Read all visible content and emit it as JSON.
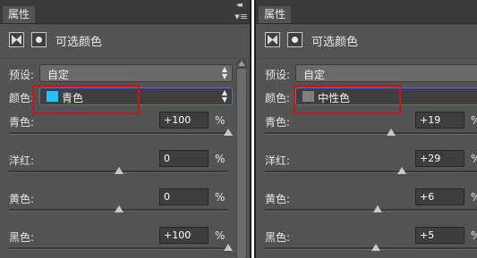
{
  "left": {
    "tab_label": "属性",
    "header_title": "可选颜色",
    "preset_label": "预设:",
    "preset_value": "自定",
    "color_label": "颜色:",
    "color_value": "青色",
    "swatch_color": "#1ec3ff",
    "sliders": [
      {
        "label": "青色:",
        "value": "+100",
        "unit": "%",
        "level": 1.0
      },
      {
        "label": "洋红:",
        "value": "0",
        "unit": "%",
        "level": 0.5
      },
      {
        "label": "黄色:",
        "value": "0",
        "unit": "%",
        "level": 0.5
      },
      {
        "label": "黑色:",
        "value": "+100",
        "unit": "%",
        "level": 1.0
      }
    ]
  },
  "right": {
    "tab_label": "属性",
    "header_title": "可选颜色",
    "preset_label": "预设:",
    "preset_value": "自定",
    "color_label": "颜色:",
    "color_value": "中性色",
    "swatch_color": "#808080",
    "sliders": [
      {
        "label": "青色:",
        "value": "+19",
        "unit": "%",
        "level": 0.595
      },
      {
        "label": "洋红:",
        "value": "+29",
        "unit": "%",
        "level": 0.645
      },
      {
        "label": "黄色:",
        "value": "+6",
        "unit": "%",
        "level": 0.53
      },
      {
        "label": "黑色:",
        "value": "+5",
        "unit": "%",
        "level": 0.525
      }
    ]
  },
  "colors": {
    "panel_bg": "#535353",
    "highlight": "#cc1414",
    "select_border": "#5b6cb0"
  }
}
